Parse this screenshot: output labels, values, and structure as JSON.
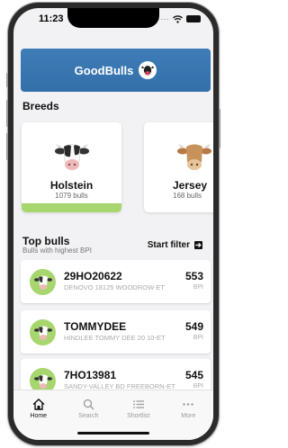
{
  "status": {
    "time": "11:23"
  },
  "header": {
    "title": "GoodBulls"
  },
  "breeds": {
    "title": "Breeds",
    "items": [
      {
        "name": "Holstein",
        "count": "1079 bulls"
      },
      {
        "name": "Jersey",
        "count": "168 bulls"
      }
    ]
  },
  "top_bulls": {
    "title": "Top bulls",
    "subtitle": "Bulls with highest BPI",
    "filter_label": "Start filter",
    "items": [
      {
        "code": "29HO20622",
        "full": "DENOVO 18125 WOODROW-ET",
        "bpi": "553",
        "unit": "BPI"
      },
      {
        "code": "TOMMYDEE",
        "full": "HINDLEE TOMMY DEE 20 10-ET",
        "bpi": "549",
        "unit": "BPI"
      },
      {
        "code": "7HO13981",
        "full": "SANDY-VALLEY BD FREEBORN-ET",
        "bpi": "545",
        "unit": "BPI"
      }
    ]
  },
  "tabs": [
    {
      "label": "Home",
      "icon": "home-icon",
      "active": true
    },
    {
      "label": "Search",
      "icon": "search-icon",
      "active": false
    },
    {
      "label": "Shortlist",
      "icon": "list-icon",
      "active": false
    },
    {
      "label": "More",
      "icon": "more-icon",
      "active": false
    }
  ],
  "colors": {
    "header_bg": "#3a77b2",
    "accent_green": "#a6d66d"
  }
}
